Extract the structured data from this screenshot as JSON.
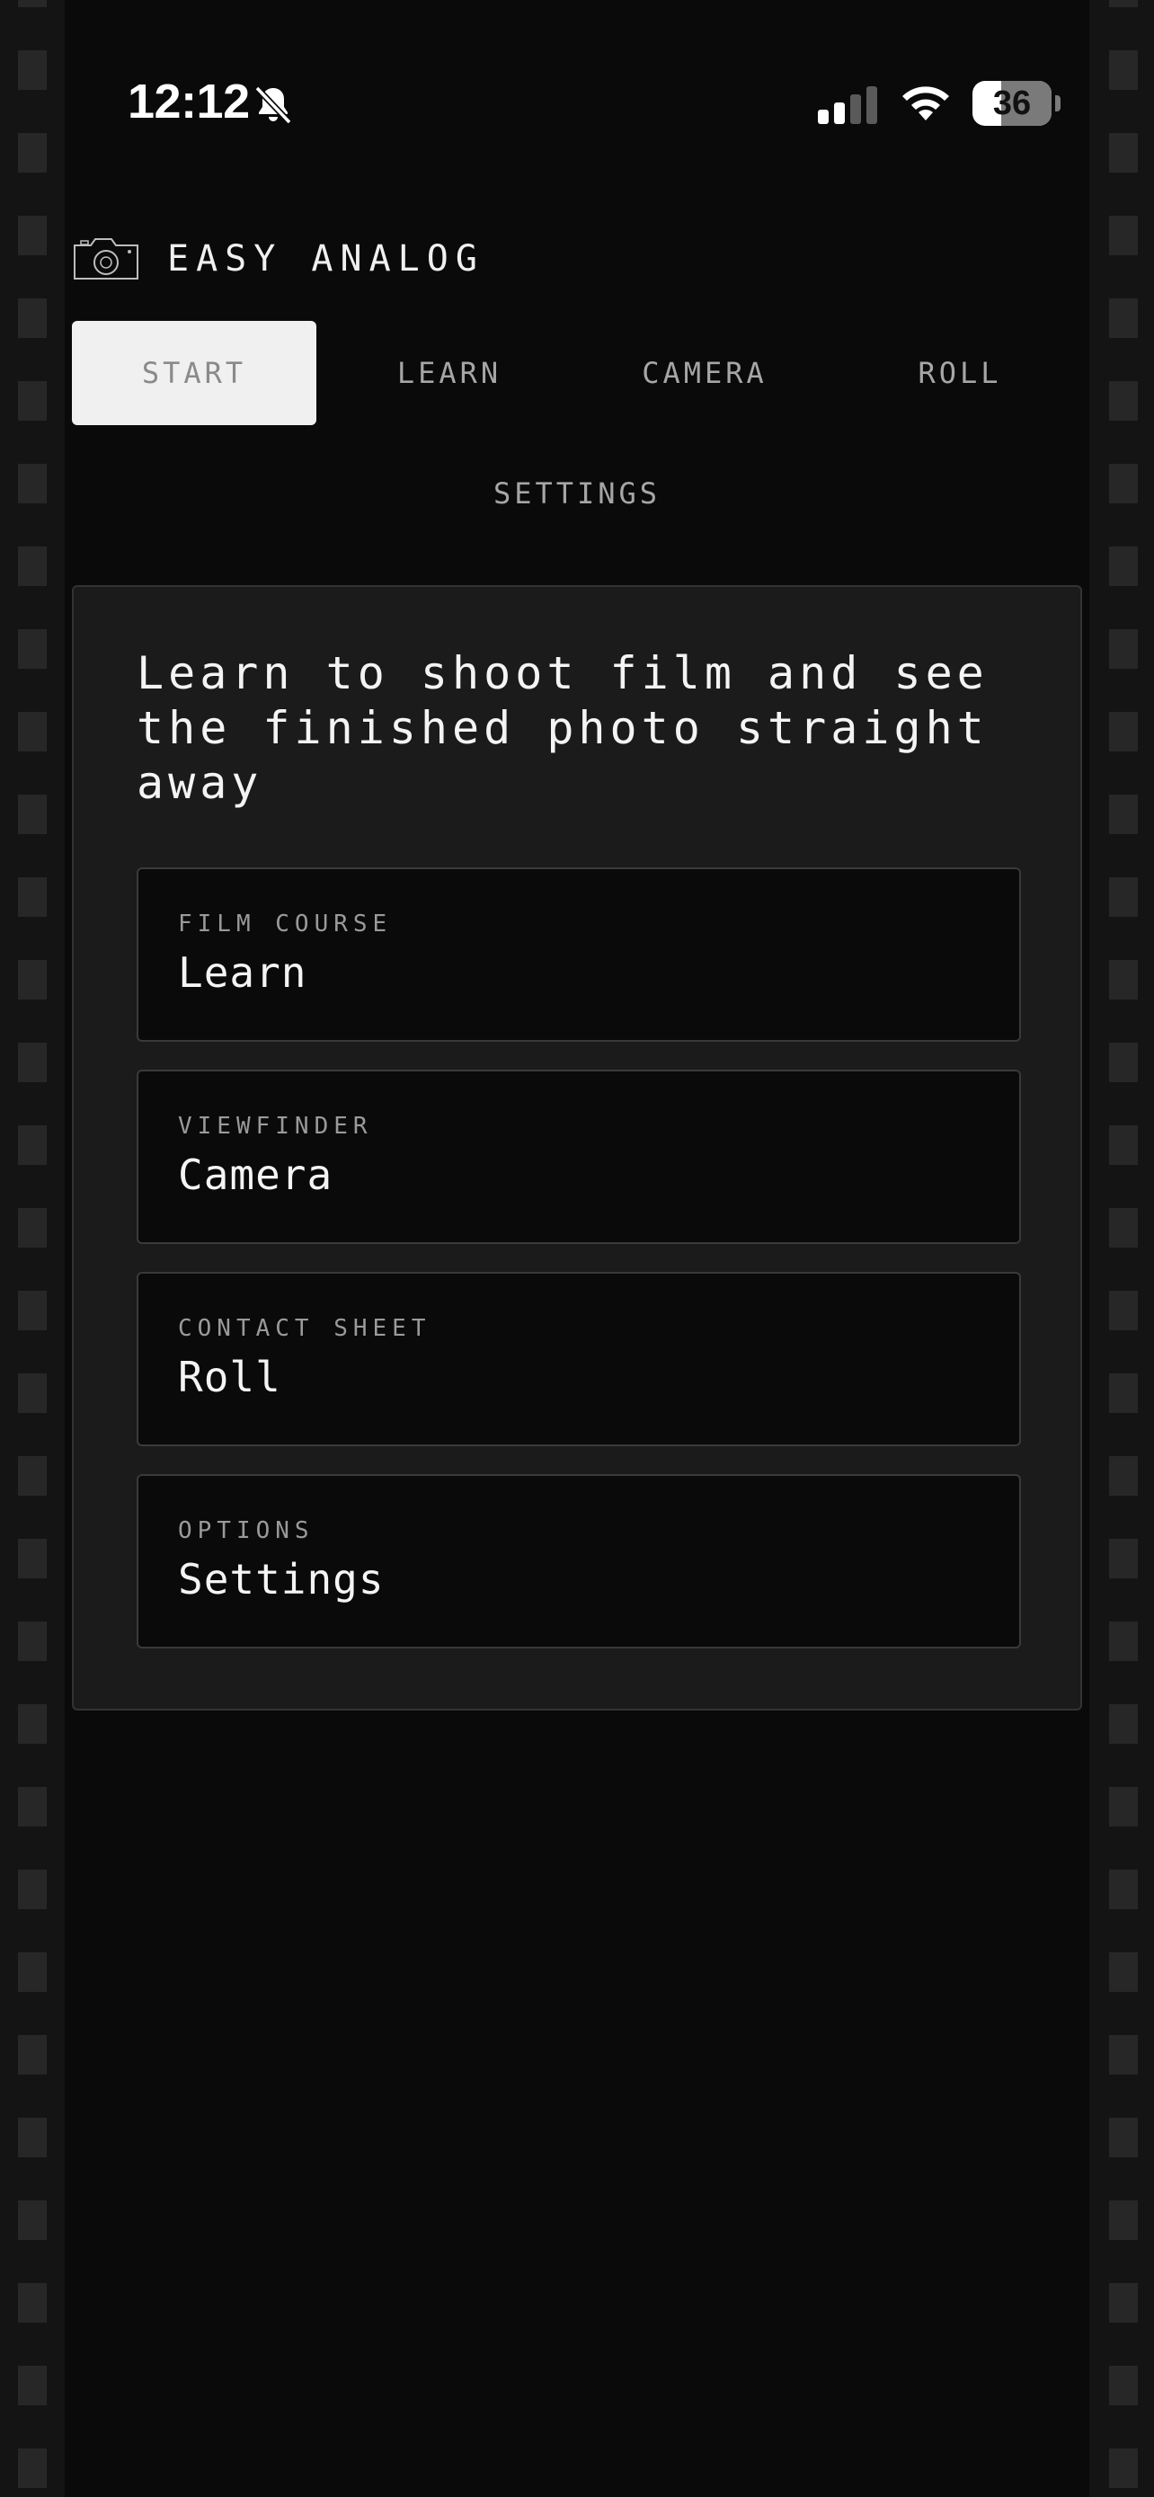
{
  "status_bar": {
    "time": "12:12",
    "battery": "36",
    "battery_level_percent": 36,
    "icons": [
      "bell-slash-icon",
      "signal-icon",
      "wifi-icon",
      "battery-icon"
    ]
  },
  "header": {
    "app_name": "EASY ANALOG",
    "icon": "camera-icon"
  },
  "tabs": [
    {
      "label": "START",
      "active": true
    },
    {
      "label": "LEARN",
      "active": false
    },
    {
      "label": "CAMERA",
      "active": false
    },
    {
      "label": "ROLL",
      "active": false
    },
    {
      "label": "SETTINGS",
      "active": false
    }
  ],
  "main": {
    "headline": "Learn to shoot film and see the finished photo straight away",
    "cards": [
      {
        "kicker": "FILM COURSE",
        "title": "Learn"
      },
      {
        "kicker": "VIEWFINDER",
        "title": "Camera"
      },
      {
        "kicker": "CONTACT SHEET",
        "title": "Roll"
      },
      {
        "kicker": "OPTIONS",
        "title": "Settings"
      }
    ]
  },
  "colors": {
    "background": "#0a0a0a",
    "panel": "#1b1b1b",
    "active_tab": "#f0f0f0",
    "text": "#f4f4f4",
    "muted_text": "#a6a6a6"
  }
}
